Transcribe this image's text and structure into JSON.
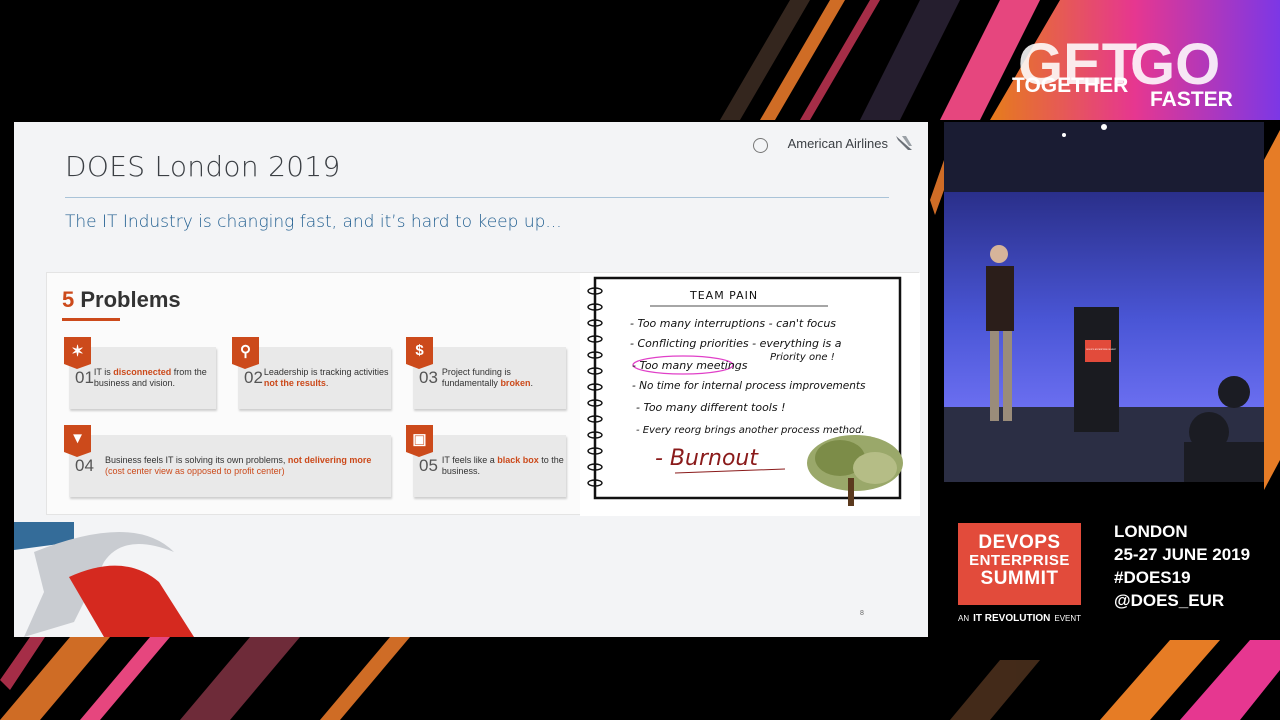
{
  "slide": {
    "title": "DOES London 2019",
    "brand": "American Airlines",
    "subtitle": "The IT Industry is changing fast, and it’s hard to keep up...",
    "problems_num": "5",
    "problems_word": "Problems",
    "page_number": "8",
    "cards": [
      {
        "num": "01",
        "icon": "puzzle-icon",
        "pre": "IT is ",
        "hl": "disconnected",
        "post": " from the business and vision.",
        "tail": ""
      },
      {
        "num": "02",
        "icon": "magnifier-icon",
        "pre": "Leadership is tracking activities ",
        "hl": "not the results",
        "post": ".",
        "tail": ""
      },
      {
        "num": "03",
        "icon": "dollar-icon",
        "pre": "Project funding is fundamentally ",
        "hl": "broken",
        "post": ".",
        "tail": ""
      },
      {
        "num": "04",
        "icon": "money-down-icon",
        "pre": "Business feels IT is solving its own problems, ",
        "hl": "not delivering more",
        "post": " ",
        "tail": "(cost center view as opposed to profit center)"
      },
      {
        "num": "05",
        "icon": "box-icon",
        "pre": "IT feels like a ",
        "hl": "black box",
        "post": " to the business.",
        "tail": ""
      }
    ],
    "notebook": {
      "heading": "TEAM PAIN",
      "lines": [
        "- Too many interruptions - can't focus",
        "- Conflicting priorities - everything is a",
        "Priority one !",
        "- Too many meetings",
        "- No time for internal process improvements",
        "- Too many different tools !",
        "- Every reorg brings another process method."
      ],
      "conclusion": "- Burnout"
    }
  },
  "branding": {
    "banner_line1": "GET",
    "banner_line2": "TOGETHER",
    "banner_line3": "GO",
    "banner_line4": "FASTER",
    "logo_line1": "DEVOPS",
    "logo_line2": "ENTERPRISE",
    "logo_line3": "SUMMIT",
    "an": "AN",
    "revolution": "IT REVOLUTION",
    "event": "EVENT",
    "podium_label": "DEVOPS ENTERPRISE SUMMIT"
  },
  "event_info": {
    "city": "LONDON",
    "dates": "25-27 JUNE 2019",
    "hashtag": "#DOES19",
    "handle": "@DOES_EUR"
  },
  "colors": {
    "accent": "#cc4a1b",
    "brand_red": "#e24b3b",
    "subtitle_blue": "#1f5d8f"
  }
}
